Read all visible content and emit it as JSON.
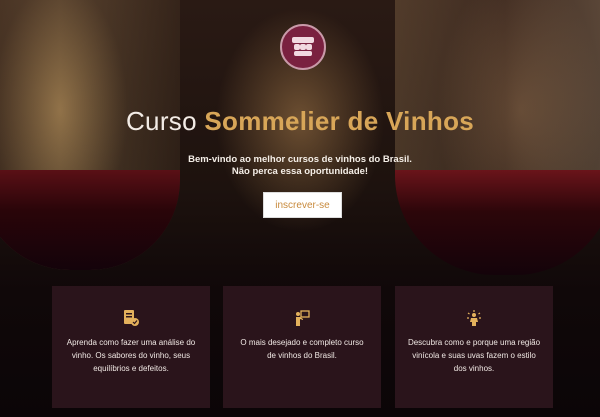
{
  "hero": {
    "title_prefix": "Curso ",
    "title_highlight": "Sommelier de Vinhos",
    "subtitle_line1": "Bem-vindo ao melhor cursos de vinhos do Brasil.",
    "subtitle_line2": "Não perca essa oportunidade!",
    "cta_label": "inscrever-se"
  },
  "logo": {
    "icon": "wine-barrels-logo"
  },
  "cards": [
    {
      "icon": "document-check-icon",
      "text": "Aprenda como fazer uma análise do vinho. Os sabores do vinho, seus equilíbrios e defeitos."
    },
    {
      "icon": "presentation-icon",
      "text": "O mais desejado e completo curso de vinhos do Brasil."
    },
    {
      "icon": "region-icon",
      "text": "Descubra como e porque uma região vinícola e suas uvas fazem o estilo dos vinhos."
    }
  ],
  "colors": {
    "accent": "#d8a658",
    "card_bg": "#2a141b",
    "logo_bg": "#7a2140"
  }
}
